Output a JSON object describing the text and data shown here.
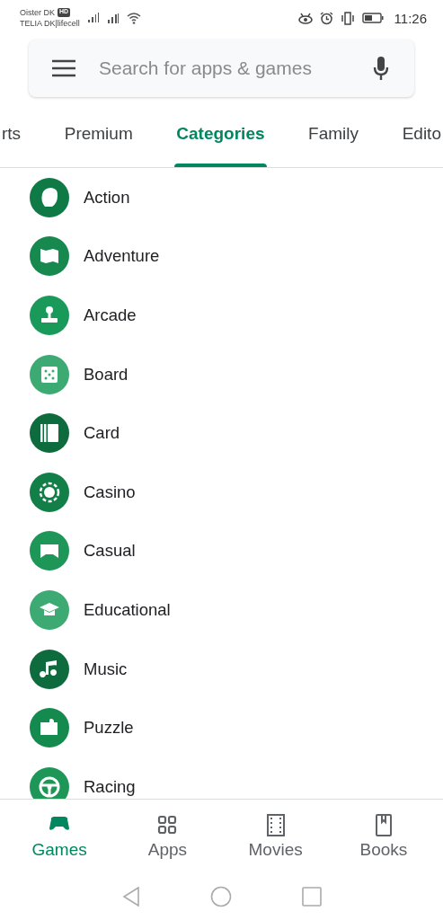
{
  "status_bar": {
    "carrier_1": "Oister DK",
    "carrier_1_badge": "HD",
    "carrier_2": "TELIA DK|lifecell",
    "time": "11:26"
  },
  "search": {
    "placeholder": "Search for apps & games"
  },
  "tabs": [
    {
      "label": "rts",
      "selected": false
    },
    {
      "label": "Premium",
      "selected": false
    },
    {
      "label": "Categories",
      "selected": true
    },
    {
      "label": "Family",
      "selected": false
    },
    {
      "label": "Edito",
      "selected": false
    }
  ],
  "categories": [
    {
      "label": "Action",
      "color": "#0f7a45"
    },
    {
      "label": "Adventure",
      "color": "#17894f"
    },
    {
      "label": "Arcade",
      "color": "#1a9a5a"
    },
    {
      "label": "Board",
      "color": "#3caa72"
    },
    {
      "label": "Card",
      "color": "#0e6b3d"
    },
    {
      "label": "Casino",
      "color": "#137f48"
    },
    {
      "label": "Casual",
      "color": "#1d9657"
    },
    {
      "label": "Educational",
      "color": "#3caa72"
    },
    {
      "label": "Music",
      "color": "#0e6b3d"
    },
    {
      "label": "Puzzle",
      "color": "#158a4e"
    },
    {
      "label": "Racing",
      "color": "#1d9657"
    }
  ],
  "bottom_nav": [
    {
      "label": "Games",
      "selected": true
    },
    {
      "label": "Apps",
      "selected": false
    },
    {
      "label": "Movies",
      "selected": false
    },
    {
      "label": "Books",
      "selected": false
    }
  ]
}
